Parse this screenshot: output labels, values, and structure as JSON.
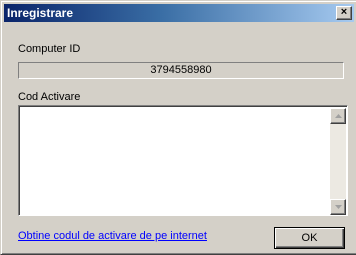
{
  "window": {
    "title": "Inregistrare",
    "close_glyph": "×"
  },
  "computer_id": {
    "label": "Computer ID",
    "value": "3794558980"
  },
  "activation": {
    "label": "Cod Activare",
    "value": ""
  },
  "footer": {
    "link_text": "Obtine codul de activare de pe internet",
    "ok_label": "OK"
  },
  "colors": {
    "titlebar_start": "#0a246a",
    "titlebar_end": "#a6caf0",
    "dialog_bg": "#d4d0c8",
    "link": "#0000ff"
  }
}
